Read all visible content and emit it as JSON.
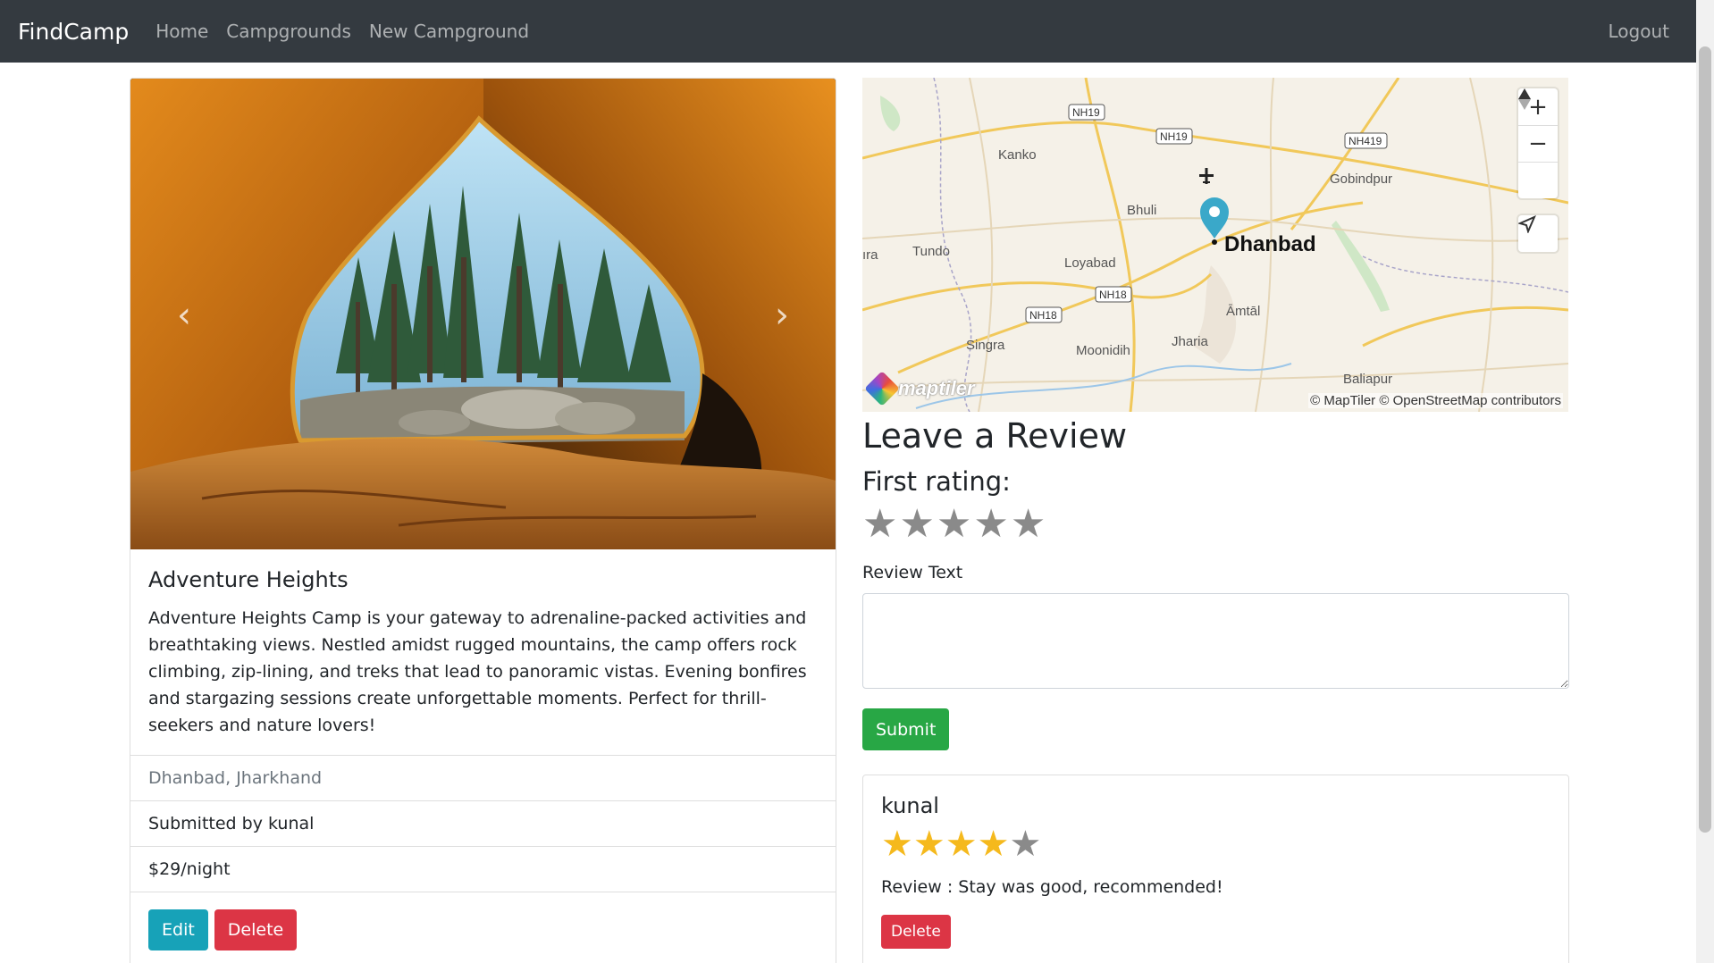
{
  "navbar": {
    "brand": "FindCamp",
    "links": [
      "Home",
      "Campgrounds",
      "New Campground"
    ],
    "logout": "Logout"
  },
  "campground": {
    "title": "Adventure Heights",
    "description": "Adventure Heights Camp is your gateway to adrenaline-packed activities and breathtaking views. Nestled amidst rugged mountains, the camp offers rock climbing, zip-lining, and treks that lead to panoramic vistas. Evening bonfires and stargazing sessions create unforgettable moments. Perfect for thrill-seekers and nature lovers!",
    "location": "Dhanbad, Jharkhand",
    "submitted_by": "Submitted by kunal",
    "price": "$29/night",
    "edit_label": "Edit",
    "delete_label": "Delete",
    "carousel_prev_icon": "chevron-left-icon",
    "carousel_next_icon": "chevron-right-icon"
  },
  "map": {
    "labels": {
      "kanko": "Kanko",
      "bhuli": "Bhuli",
      "gobindpur": "Gobindpur",
      "dhanbad": "Dhanbad",
      "tundo": "Tundo",
      "loyabad": "Loyabad",
      "amtal": "Āmtāl",
      "singra": "Singra",
      "moonidih": "Moonidih",
      "jharia": "Jharia",
      "baliapur": "Baliapur",
      "ara": "ıra"
    },
    "road_shields": [
      "NH19",
      "NH19",
      "NH419",
      "NH18",
      "NH18"
    ],
    "attribution": "© MapTiler © OpenStreetMap contributors",
    "logo_text": "maptiler",
    "controls": [
      "zoom-in-icon",
      "zoom-out-icon",
      "compass-icon",
      "geolocate-icon"
    ],
    "zoom_in": "+",
    "zoom_out": "−"
  },
  "review_form": {
    "heading": "Leave a Review",
    "rating_label": "First rating:",
    "text_label": "Review Text",
    "textarea_value": "",
    "submit_label": "Submit",
    "rating_value": 0,
    "rating_max": 5
  },
  "reviews": [
    {
      "author": "kunal",
      "rating": 4,
      "rating_max": 5,
      "text": "Review : Stay was good, recommended!",
      "delete_label": "Delete"
    }
  ],
  "colors": {
    "navbar": "#343a40",
    "edit_button": "#17a2b8",
    "delete_button": "#dc3545",
    "submit_button": "#28a745",
    "star_on": "#f5b91d",
    "star_off": "#8a8a8a",
    "map_pin": "#3aa8c9"
  }
}
